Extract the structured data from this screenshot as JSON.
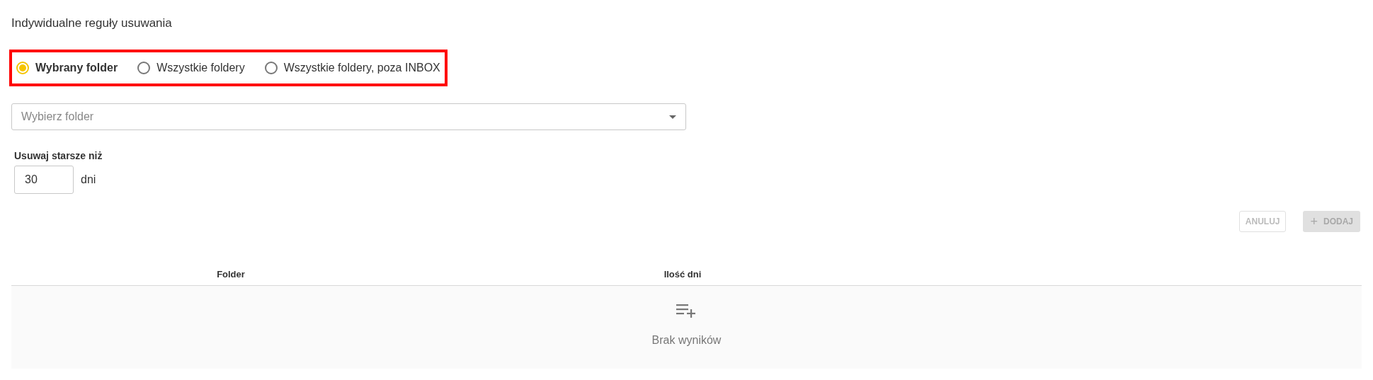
{
  "title": "Indywidualne reguły usuwania",
  "scope_options": [
    {
      "label": "Wybrany folder",
      "selected": true
    },
    {
      "label": "Wszystkie foldery",
      "selected": false
    },
    {
      "label": "Wszystkie foldery, poza INBOX",
      "selected": false
    }
  ],
  "folder_select": {
    "placeholder": "Wybierz folder"
  },
  "age_field": {
    "label": "Usuwaj starsze niż",
    "value": "30",
    "unit": "dni"
  },
  "buttons": [
    {
      "kind": "outline",
      "label": "ANULUJ",
      "disabled": true
    },
    {
      "kind": "add",
      "label": "DODAJ",
      "icon": "+",
      "disabled": true
    }
  ],
  "table": {
    "columns": [
      "Folder",
      "Ilość dni"
    ],
    "empty_message": "Brak wyników"
  }
}
